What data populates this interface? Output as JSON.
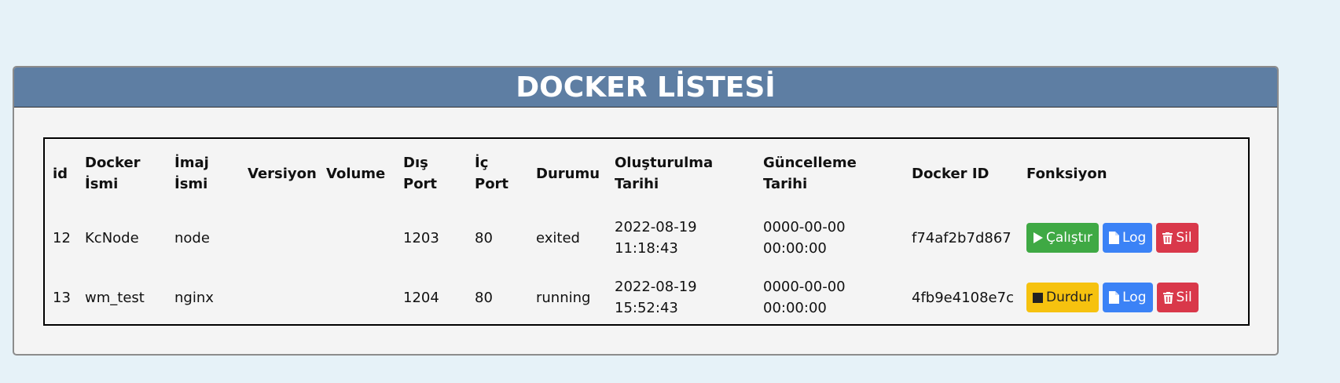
{
  "panel": {
    "title": "DOCKER LİSTESİ"
  },
  "table": {
    "headers": {
      "id": "id",
      "docker_name": [
        "Docker",
        "İsmi"
      ],
      "image_name": [
        "İmaj",
        "İsmi"
      ],
      "version": "Versiyon",
      "volume": "Volume",
      "ext_port": [
        "Dış",
        "Port"
      ],
      "int_port": [
        "İç",
        "Port"
      ],
      "status": "Durumu",
      "created": [
        "Oluşturulma",
        "Tarihi"
      ],
      "updated": [
        "Güncelleme",
        "Tarihi"
      ],
      "docker_id": "Docker ID",
      "function": "Fonksiyon"
    },
    "rows": [
      {
        "id": "12",
        "name": "KcNode",
        "image": "node",
        "version": "",
        "volume": "",
        "ext_port": "1203",
        "int_port": "80",
        "status": "exited",
        "created": [
          "2022-08-19",
          "11:18:43"
        ],
        "updated": [
          "0000-00-00",
          "00:00:00"
        ],
        "docker_id": "f74af2b7d867",
        "actions": [
          {
            "label": "Çalıştır",
            "icon": "play-icon",
            "color": "#3fa944"
          },
          {
            "label": "Log",
            "icon": "file-icon",
            "color": "#3b82f6"
          },
          {
            "label": "Sil",
            "icon": "trash-icon",
            "color": "#d9384a"
          }
        ]
      },
      {
        "id": "13",
        "name": "wm_test",
        "image": "nginx",
        "version": "",
        "volume": "",
        "ext_port": "1204",
        "int_port": "80",
        "status": "running",
        "created": [
          "2022-08-19",
          "15:52:43"
        ],
        "updated": [
          "0000-00-00",
          "00:00:00"
        ],
        "docker_id": "4fb9e4108e7c",
        "actions": [
          {
            "label": "Durdur",
            "icon": "stop-icon",
            "color": "#f6c20f"
          },
          {
            "label": "Log",
            "icon": "file-icon",
            "color": "#3b82f6"
          },
          {
            "label": "Sil",
            "icon": "trash-icon",
            "color": "#d9384a"
          }
        ]
      }
    ]
  }
}
